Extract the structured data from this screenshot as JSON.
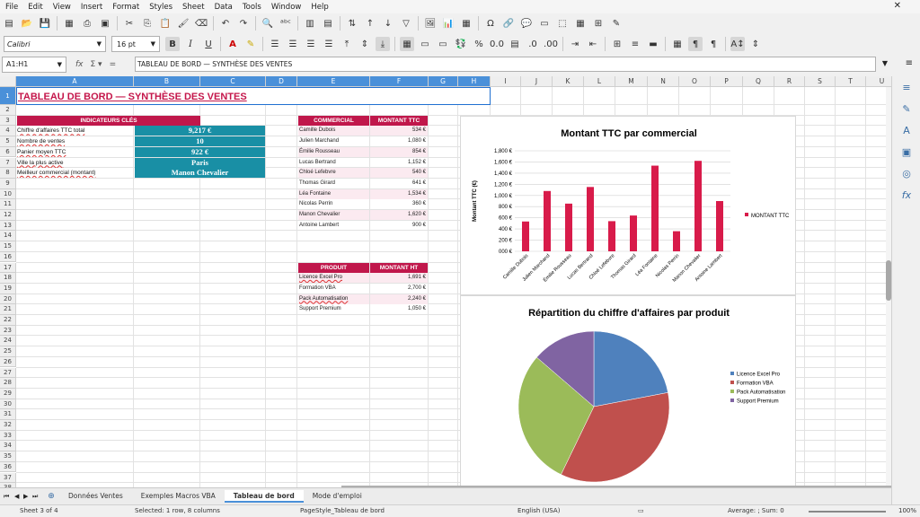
{
  "menu": [
    "File",
    "Edit",
    "View",
    "Insert",
    "Format",
    "Styles",
    "Sheet",
    "Data",
    "Tools",
    "Window",
    "Help"
  ],
  "toolbar": {
    "font_name": "Calibri",
    "font_size": "16 pt"
  },
  "formula": {
    "cell_ref": "A1:H1",
    "content": "TABLEAU DE BORD — SYNTHÈSE DES VENTES"
  },
  "columns": [
    {
      "name": "A",
      "sel": true
    },
    {
      "name": "B",
      "sel": true
    },
    {
      "name": "C",
      "sel": true
    },
    {
      "name": "D",
      "sel": true
    },
    {
      "name": "E",
      "sel": true
    },
    {
      "name": "F",
      "sel": true
    },
    {
      "name": "G",
      "sel": true
    },
    {
      "name": "H",
      "sel": true
    },
    {
      "name": "I"
    },
    {
      "name": "J"
    },
    {
      "name": "K"
    },
    {
      "name": "L"
    },
    {
      "name": "M"
    },
    {
      "name": "N"
    },
    {
      "name": "O"
    },
    {
      "name": "P"
    },
    {
      "name": "Q"
    },
    {
      "name": "R"
    },
    {
      "name": "S"
    },
    {
      "name": "T"
    },
    {
      "name": "U"
    }
  ],
  "rows": [
    "1",
    "2",
    "3",
    "4",
    "5",
    "6",
    "7",
    "8",
    "9",
    "10",
    "11",
    "12",
    "13",
    "14",
    "15",
    "16",
    "17",
    "18",
    "19",
    "20",
    "21",
    "22",
    "23",
    "24",
    "25",
    "26",
    "27",
    "28",
    "29",
    "30",
    "31",
    "32",
    "33",
    "34",
    "35",
    "36",
    "37",
    "38"
  ],
  "sheet": {
    "title": "TABLEAU DE BORD — SYNTHÈSE DES VENTES",
    "kpi_header": "INDICATEURS CLÉS",
    "kpis": [
      {
        "label": "Chiffre d'affaires TTC total",
        "value": "9,217 €"
      },
      {
        "label": "Nombre de ventes",
        "value": "10"
      },
      {
        "label": "Panier moyen TTC",
        "value": "922 €"
      },
      {
        "label": "Ville la plus active",
        "value": "Paris"
      },
      {
        "label": "Meilleur commercial (montant)",
        "value": "Manon Chevalier"
      }
    ],
    "commercial_header": [
      "COMMERCIAL",
      "MONTANT TTC"
    ],
    "commercial_rows": [
      [
        "Camille Dubois",
        "534 €"
      ],
      [
        "Julien Marchand",
        "1,080 €"
      ],
      [
        "Émilie Rousseau",
        "854 €"
      ],
      [
        "Lucas Bertrand",
        "1,152 €"
      ],
      [
        "Chloé Lefebvre",
        "540 €"
      ],
      [
        "Thomas Girard",
        "641 €"
      ],
      [
        "Léa Fontaine",
        "1,534 €"
      ],
      [
        "Nicolas Perrin",
        "360 €"
      ],
      [
        "Manon Chevalier",
        "1,620 €"
      ],
      [
        "Antoine Lambert",
        "900 €"
      ]
    ],
    "produit_header": [
      "PRODUIT",
      "MONTANT HT"
    ],
    "produit_rows": [
      [
        "Licence Excel Pro",
        "1,691 €"
      ],
      [
        "Formation VBA",
        "2,700 €"
      ],
      [
        "Pack Automatisation",
        "2,240 €"
      ],
      [
        "Support Premium",
        "1,050 €"
      ]
    ]
  },
  "chart_data": [
    {
      "type": "bar",
      "title": "Montant TTC par commercial",
      "ylabel": "Montant TTC (€)",
      "xlabel": "",
      "ylim": [
        0,
        1800
      ],
      "yticks": [
        "000 €",
        "200 €",
        "400 €",
        "600 €",
        "800 €",
        "1,000 €",
        "1,200 €",
        "1,400 €",
        "1,600 €",
        "1,800 €"
      ],
      "categories": [
        "Camille Dubois",
        "Julien Marchand",
        "Émilie Rousseau",
        "Lucas Bertrand",
        "Chloé Lefebvre",
        "Thomas Girard",
        "Léa Fontaine",
        "Nicolas Perrin",
        "Manon Chevalier",
        "Antoine Lambert"
      ],
      "series": [
        {
          "name": "MONTANT TTC",
          "values": [
            534,
            1080,
            854,
            1152,
            540,
            641,
            1534,
            360,
            1620,
            900
          ],
          "color": "#d81b4a"
        }
      ],
      "legend": "right",
      "grid": true
    },
    {
      "type": "pie",
      "title": "Répartition du chiffre d'affaires par produit",
      "categories": [
        "Licence Excel Pro",
        "Formation VBA",
        "Pack Automatisation",
        "Support Premium"
      ],
      "values": [
        1691,
        2700,
        2240,
        1050
      ],
      "colors": [
        "#4f81bd",
        "#c0504d",
        "#9bbb59",
        "#8064a2"
      ],
      "legend": "right"
    }
  ],
  "sheet_tabs": [
    {
      "label": "Données Ventes",
      "active": false
    },
    {
      "label": "Exemples Macros VBA",
      "active": false
    },
    {
      "label": "Tableau de bord",
      "active": true
    },
    {
      "label": "Mode d'emploi",
      "active": false
    }
  ],
  "status": {
    "sheet": "Sheet 3 of 4",
    "selection": "Selected: 1 row, 8 columns",
    "page_style": "PageStyle_Tableau de bord",
    "language": "English (USA)",
    "summary": "Average: ; Sum: 0",
    "zoom": "100%"
  }
}
